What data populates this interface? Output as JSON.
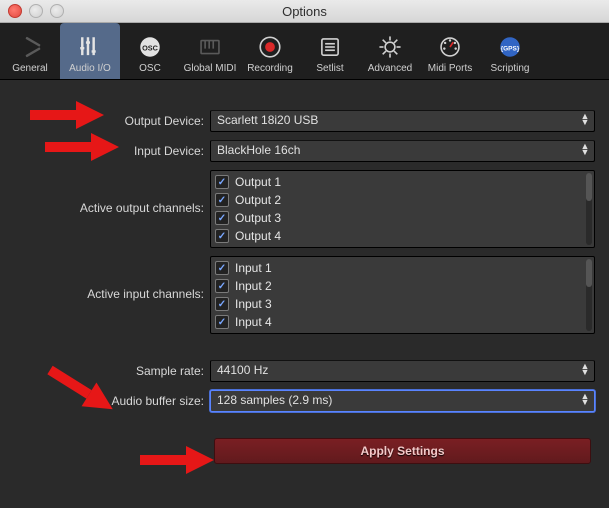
{
  "window_title": "Options",
  "tabs": {
    "items": [
      {
        "label": "General"
      },
      {
        "label": "Audio I/O"
      },
      {
        "label": "OSC"
      },
      {
        "label": "Global MIDI"
      },
      {
        "label": "Recording"
      },
      {
        "label": "Setlist"
      },
      {
        "label": "Advanced"
      },
      {
        "label": "Midi Ports"
      },
      {
        "label": "Scripting"
      }
    ]
  },
  "labels": {
    "output_device": "Output Device:",
    "input_device": "Input Device:",
    "active_output_channels": "Active output channels:",
    "active_input_channels": "Active input channels:",
    "sample_rate": "Sample rate:",
    "audio_buffer_size": "Audio buffer size:",
    "apply": "Apply Settings"
  },
  "values": {
    "output_device": "Scarlett 18i20 USB",
    "input_device": "BlackHole 16ch",
    "sample_rate": "44100 Hz",
    "audio_buffer_size": "128 samples (2.9 ms)",
    "output_channels": [
      "Output 1",
      "Output 2",
      "Output 3",
      "Output 4"
    ],
    "input_channels": [
      "Input 1",
      "Input 2",
      "Input 3",
      "Input 4"
    ]
  },
  "icon_text": {
    "osc": "OSC",
    "gps": "{GPS}"
  }
}
